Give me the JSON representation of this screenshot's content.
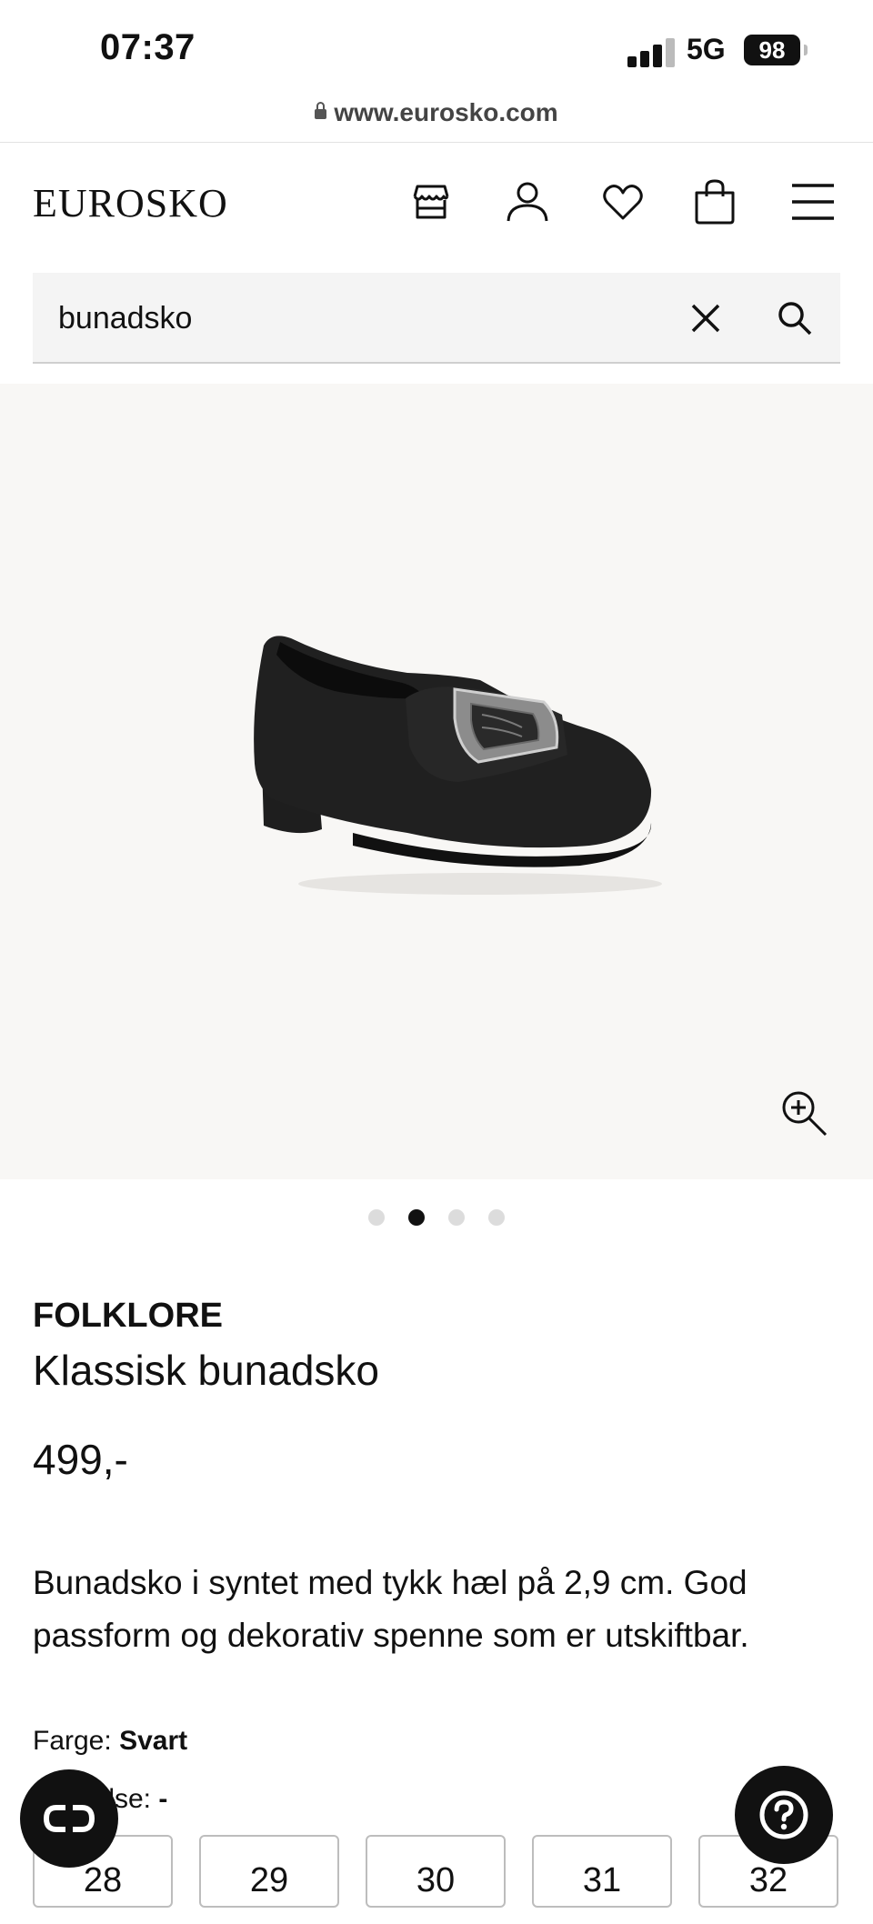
{
  "status_bar": {
    "time": "07:37",
    "network": "5G",
    "battery": "98"
  },
  "browser": {
    "url": "www.eurosko.com"
  },
  "header": {
    "logo": "EUROSKO",
    "icons": [
      "store-icon",
      "user-icon",
      "heart-icon",
      "bag-icon",
      "menu-icon"
    ]
  },
  "search": {
    "value": "bunadsko"
  },
  "gallery": {
    "slide_count": 4,
    "active_slide": 2
  },
  "product": {
    "brand": "FOLKLORE",
    "name": "Klassisk bunadsko",
    "price": "499,-",
    "description": "Bunadsko i syntet med tykk hæl på 2,9 cm. God passform og dekorativ spenne som er utskiftbar.",
    "color_label": "Farge:",
    "color_value": "Svart",
    "size_label": "Størrelse:",
    "size_value": "-",
    "sizes": [
      "28",
      "29",
      "30",
      "31",
      "32"
    ]
  }
}
